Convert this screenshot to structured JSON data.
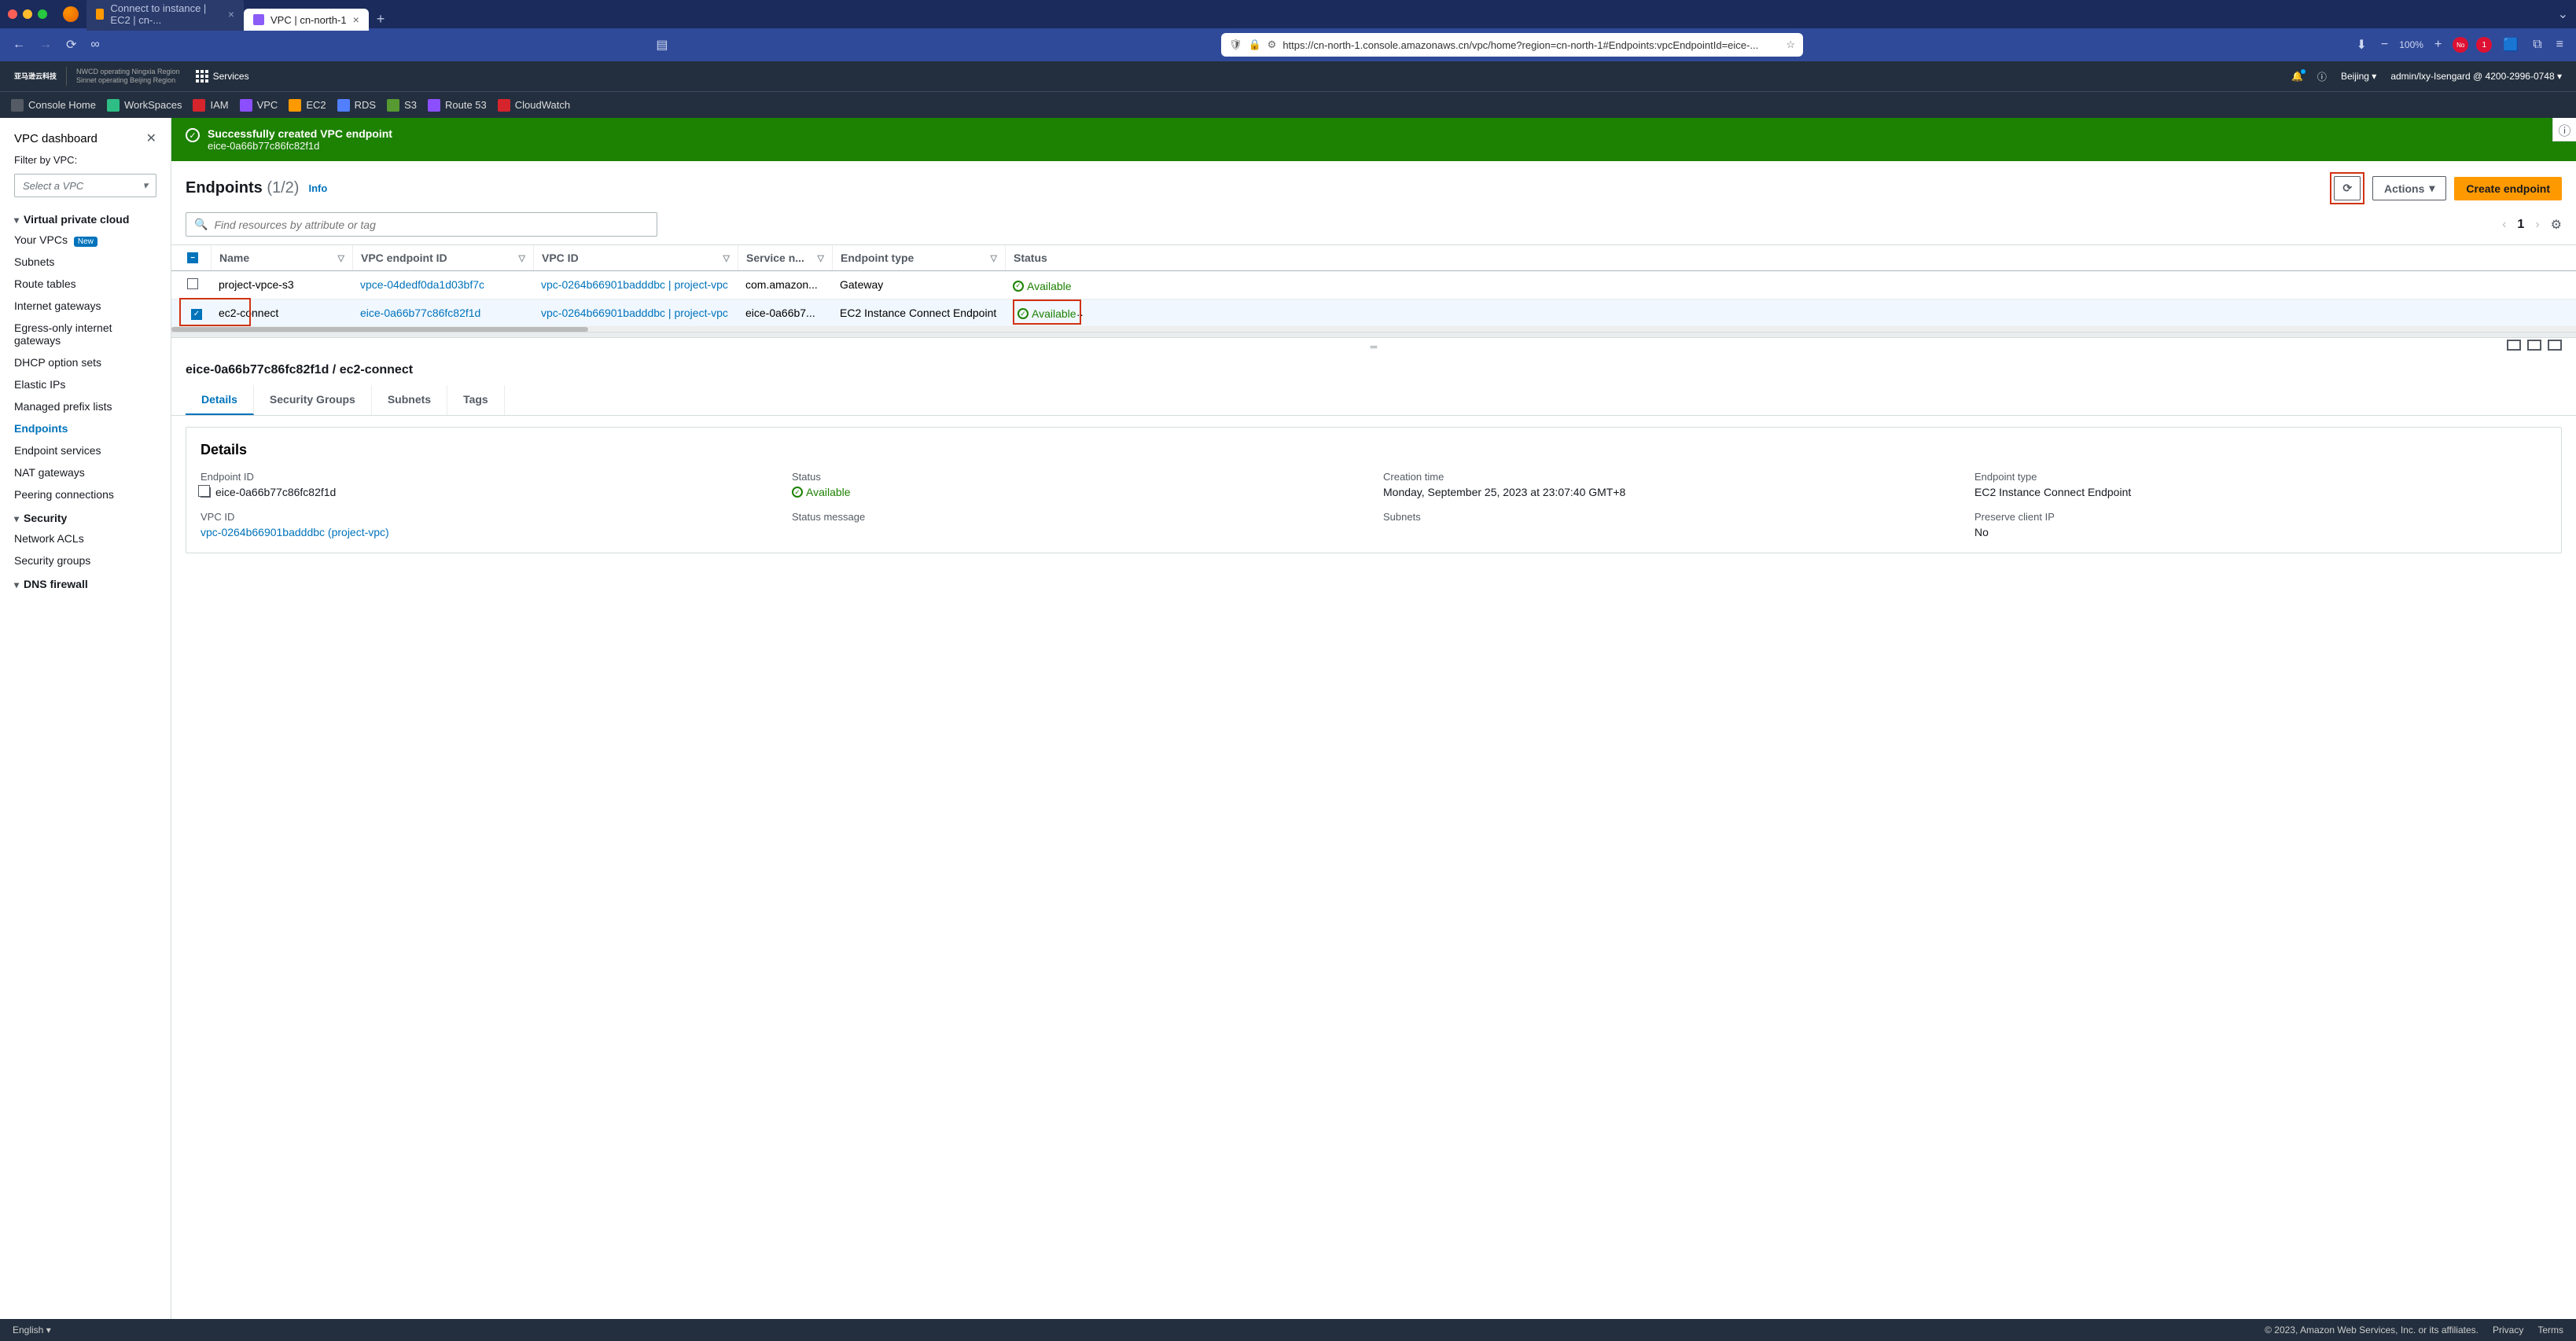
{
  "browser": {
    "tabs": [
      {
        "icon": "ec2",
        "title": "Connect to instance | EC2 | cn-...",
        "active": false
      },
      {
        "icon": "vpc",
        "title": "VPC | cn-north-1",
        "active": true
      }
    ],
    "url": "https://cn-north-1.console.amazonaws.cn/vpc/home?region=cn-north-1#Endpoints:vpcEndpointId=eice-...",
    "zoom": "100%"
  },
  "aws_header": {
    "logo_top": "亚马逊云科技",
    "operator1": "NWCD operating Ningxia Region",
    "operator2": "Sinnet operating Beijing Region",
    "services": "Services",
    "region": "Beijing",
    "account": "admin/lxy-Isengard @ 4200-2996-0748"
  },
  "fav_bar": [
    {
      "label": "Console Home",
      "color": "#545b64"
    },
    {
      "label": "WorkSpaces",
      "color": "#2dbd85"
    },
    {
      "label": "IAM",
      "color": "#d6242d"
    },
    {
      "label": "VPC",
      "color": "#8c4fff"
    },
    {
      "label": "EC2",
      "color": "#ff9900"
    },
    {
      "label": "RDS",
      "color": "#527fff"
    },
    {
      "label": "S3",
      "color": "#569a31"
    },
    {
      "label": "Route 53",
      "color": "#8c4fff"
    },
    {
      "label": "CloudWatch",
      "color": "#d6242d"
    }
  ],
  "sidebar": {
    "dashboard": "VPC dashboard",
    "filter_label": "Filter by VPC:",
    "filter_placeholder": "Select a VPC",
    "sections": [
      {
        "title": "Virtual private cloud",
        "items": [
          {
            "label": "Your VPCs",
            "new": true,
            "new_text": "New"
          },
          {
            "label": "Subnets"
          },
          {
            "label": "Route tables"
          },
          {
            "label": "Internet gateways"
          },
          {
            "label": "Egress-only internet gateways"
          },
          {
            "label": "DHCP option sets"
          },
          {
            "label": "Elastic IPs"
          },
          {
            "label": "Managed prefix lists"
          },
          {
            "label": "Endpoints",
            "active": true
          },
          {
            "label": "Endpoint services"
          },
          {
            "label": "NAT gateways"
          },
          {
            "label": "Peering connections"
          }
        ]
      },
      {
        "title": "Security",
        "items": [
          {
            "label": "Network ACLs"
          },
          {
            "label": "Security groups"
          }
        ]
      },
      {
        "title": "DNS firewall",
        "items": []
      }
    ]
  },
  "banner": {
    "title": "Successfully created VPC endpoint",
    "id": "eice-0a66b77c86fc82f1d"
  },
  "panel": {
    "title": "Endpoints",
    "count": "(1/2)",
    "info": "Info",
    "actions": "Actions",
    "create": "Create endpoint",
    "search_placeholder": "Find resources by attribute or tag",
    "page": "1"
  },
  "table": {
    "headers": [
      "Name",
      "VPC endpoint ID",
      "VPC ID",
      "Service n...",
      "Endpoint type",
      "Status"
    ],
    "rows": [
      {
        "checked": false,
        "name": "project-vpce-s3",
        "endpoint_id": "vpce-04dedf0da1d03bf7c",
        "vpc_id": "vpc-0264b66901badddbc | project-vpc",
        "service": "com.amazon...",
        "type": "Gateway",
        "status": "Available"
      },
      {
        "checked": true,
        "name": "ec2-connect",
        "endpoint_id": "eice-0a66b77c86fc82f1d",
        "vpc_id": "vpc-0264b66901badddbc | project-vpc",
        "service": "eice-0a66b7...",
        "type": "EC2 Instance Connect Endpoint",
        "status": "Available"
      }
    ]
  },
  "detail": {
    "title": "eice-0a66b77c86fc82f1d / ec2-connect",
    "tabs": [
      "Details",
      "Security Groups",
      "Subnets",
      "Tags"
    ],
    "card_title": "Details",
    "fields": [
      {
        "label": "Endpoint ID",
        "value": "eice-0a66b77c86fc82f1d",
        "copy": true
      },
      {
        "label": "Status",
        "value": "Available",
        "status": true
      },
      {
        "label": "Creation time",
        "value": "Monday, September 25, 2023 at 23:07:40 GMT+8"
      },
      {
        "label": "Endpoint type",
        "value": "EC2 Instance Connect Endpoint"
      },
      {
        "label": "VPC ID",
        "value": "vpc-0264b66901badddbc (project-vpc)",
        "link": true
      },
      {
        "label": "Status message",
        "value": ""
      },
      {
        "label": "Subnets",
        "value": ""
      },
      {
        "label": "Preserve client IP",
        "value": "No"
      }
    ]
  },
  "footer": {
    "lang": "English",
    "copyright": "© 2023, Amazon Web Services, Inc. or its affiliates.",
    "privacy": "Privacy",
    "terms": "Terms"
  }
}
